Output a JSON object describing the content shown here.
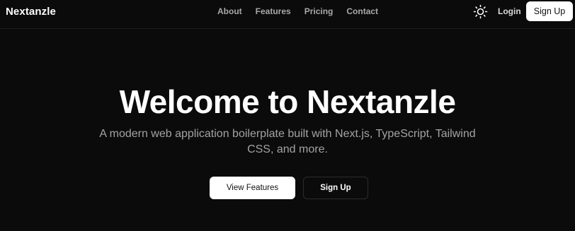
{
  "navbar": {
    "brand": "Nextanzle",
    "links": [
      {
        "label": "About"
      },
      {
        "label": "Features"
      },
      {
        "label": "Pricing"
      },
      {
        "label": "Contact"
      }
    ],
    "theme_toggle_icon": "sun-icon",
    "login_label": "Login",
    "signup_label": "Sign Up"
  },
  "hero": {
    "title": "Welcome to Nextanzle",
    "subtitle": "A modern web application boilerplate built with Next.js, TypeScript, Tailwind CSS, and more.",
    "primary_button": "View Features",
    "secondary_button": "Sign Up"
  },
  "colors": {
    "background": "#0b0b0b",
    "primary": "#ffffff",
    "muted_text": "#a3a3a3"
  }
}
